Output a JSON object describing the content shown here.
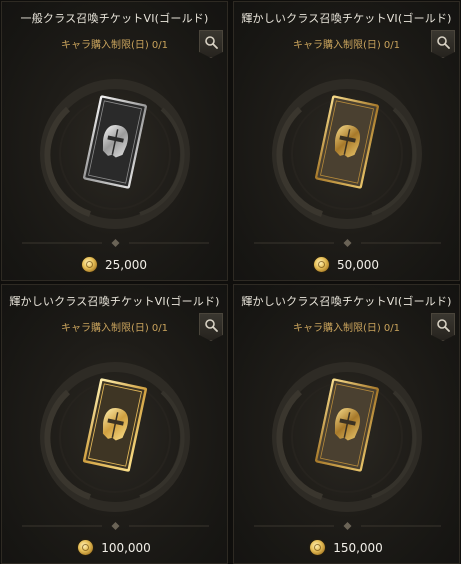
{
  "tickets": [
    {
      "title": "一般クラス召喚チケットVI(ゴールド)",
      "limit": "キャラ購入制限(日) 0/1",
      "price": "25,000",
      "tier": "silver",
      "search_icon": "search-icon",
      "currency_icon": "gold-coin-icon"
    },
    {
      "title": "輝かしいクラス召喚チケットVI(ゴールド)",
      "limit": "キャラ購入制限(日) 0/1",
      "price": "50,000",
      "tier": "gold-dark",
      "search_icon": "search-icon",
      "currency_icon": "gold-coin-icon"
    },
    {
      "title": "輝かしいクラス召喚チケットVI(ゴールド)",
      "limit": "キャラ購入制限(日) 0/1",
      "price": "100,000",
      "tier": "gold-bright",
      "search_icon": "search-icon",
      "currency_icon": "gold-coin-icon"
    },
    {
      "title": "輝かしいクラス召喚チケットVI(ゴールド)",
      "limit": "キャラ購入制限(日) 0/1",
      "price": "150,000",
      "tier": "gold-dark",
      "search_icon": "search-icon",
      "currency_icon": "gold-coin-icon"
    }
  ],
  "colors": {
    "title": "#e8e4da",
    "limit": "#c9a35c",
    "price": "#f2efe8",
    "gold": "#d6b25a",
    "silver": "#cfcfcf"
  }
}
